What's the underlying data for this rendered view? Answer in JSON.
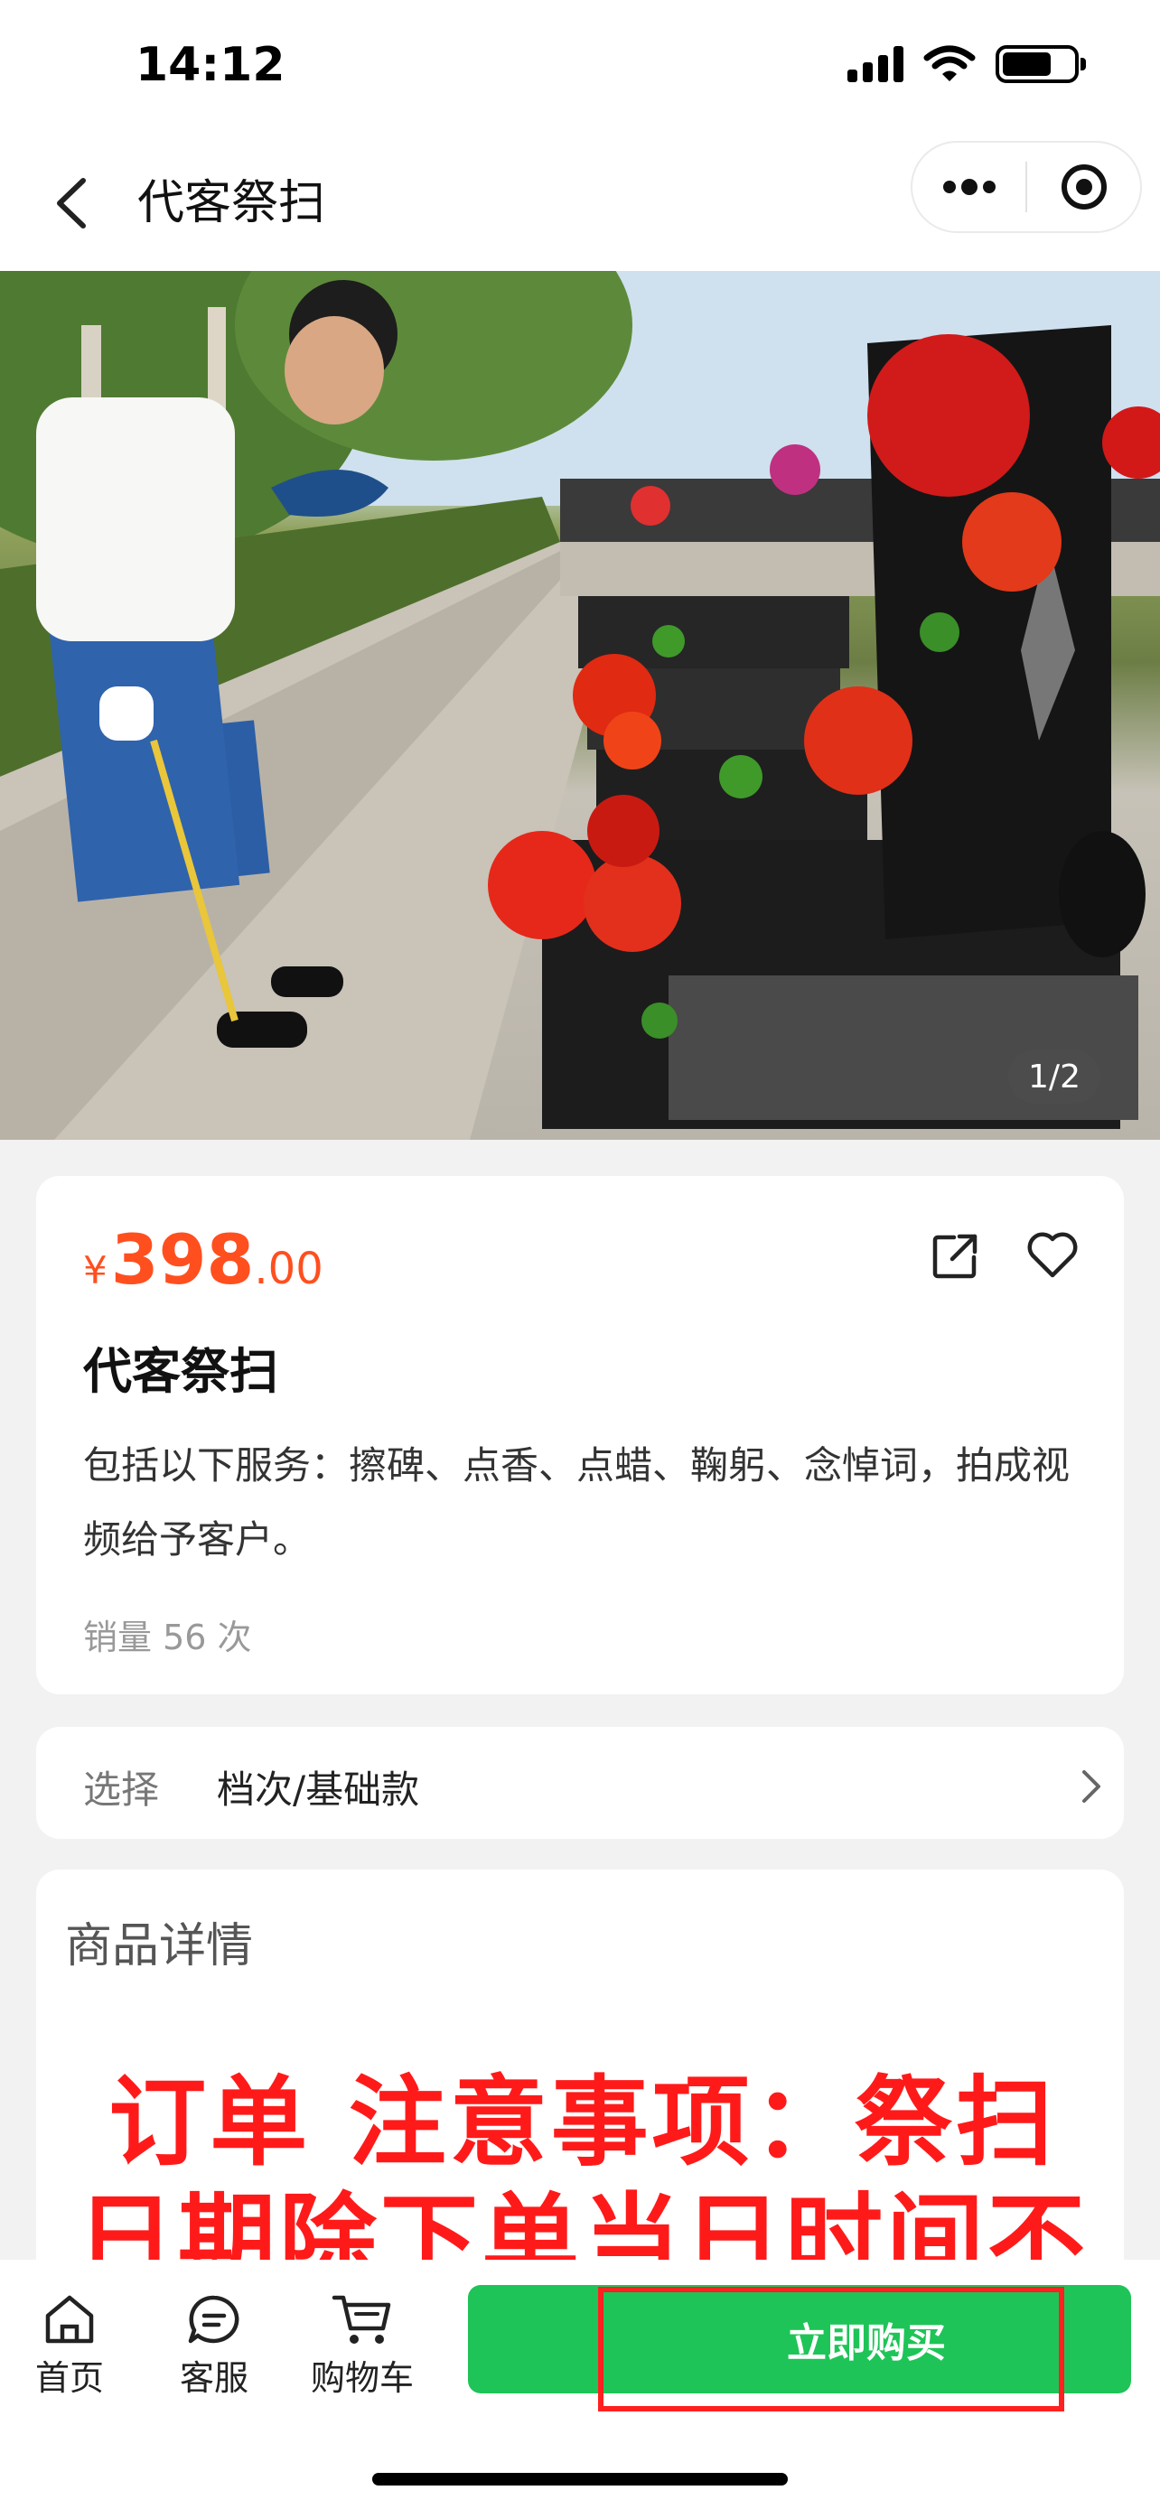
{
  "status_bar": {
    "time": "14:12"
  },
  "nav": {
    "title": "代客祭扫"
  },
  "gallery": {
    "indicator": "1/2",
    "current": 1,
    "total": 2
  },
  "product": {
    "currency": "¥",
    "price_int": "398",
    "price_dec": ".00",
    "name": "代客祭扫",
    "description": "包括以下服务：擦碑、点香、点蜡、鞠躬、念悼词，拍成视频给予客户。",
    "sales": "销量 56 次"
  },
  "spec": {
    "label": "选择",
    "value": "档次/基础款"
  },
  "details": {
    "title": "商品详情",
    "notice_line1": "订单 注意事项：祭扫",
    "notice_line2": "日期除下单当日时间不"
  },
  "bottom_bar": {
    "tabs": [
      {
        "label": "首页",
        "icon": "home-icon"
      },
      {
        "label": "客服",
        "icon": "chat-icon"
      },
      {
        "label": "购物车",
        "icon": "cart-icon"
      }
    ],
    "buy_label": "立即购买"
  },
  "colors": {
    "price": "#ff4f1f",
    "buy_button": "#1ec457",
    "notice_text": "#ff1a1a",
    "highlight_frame": "#ff2020"
  }
}
